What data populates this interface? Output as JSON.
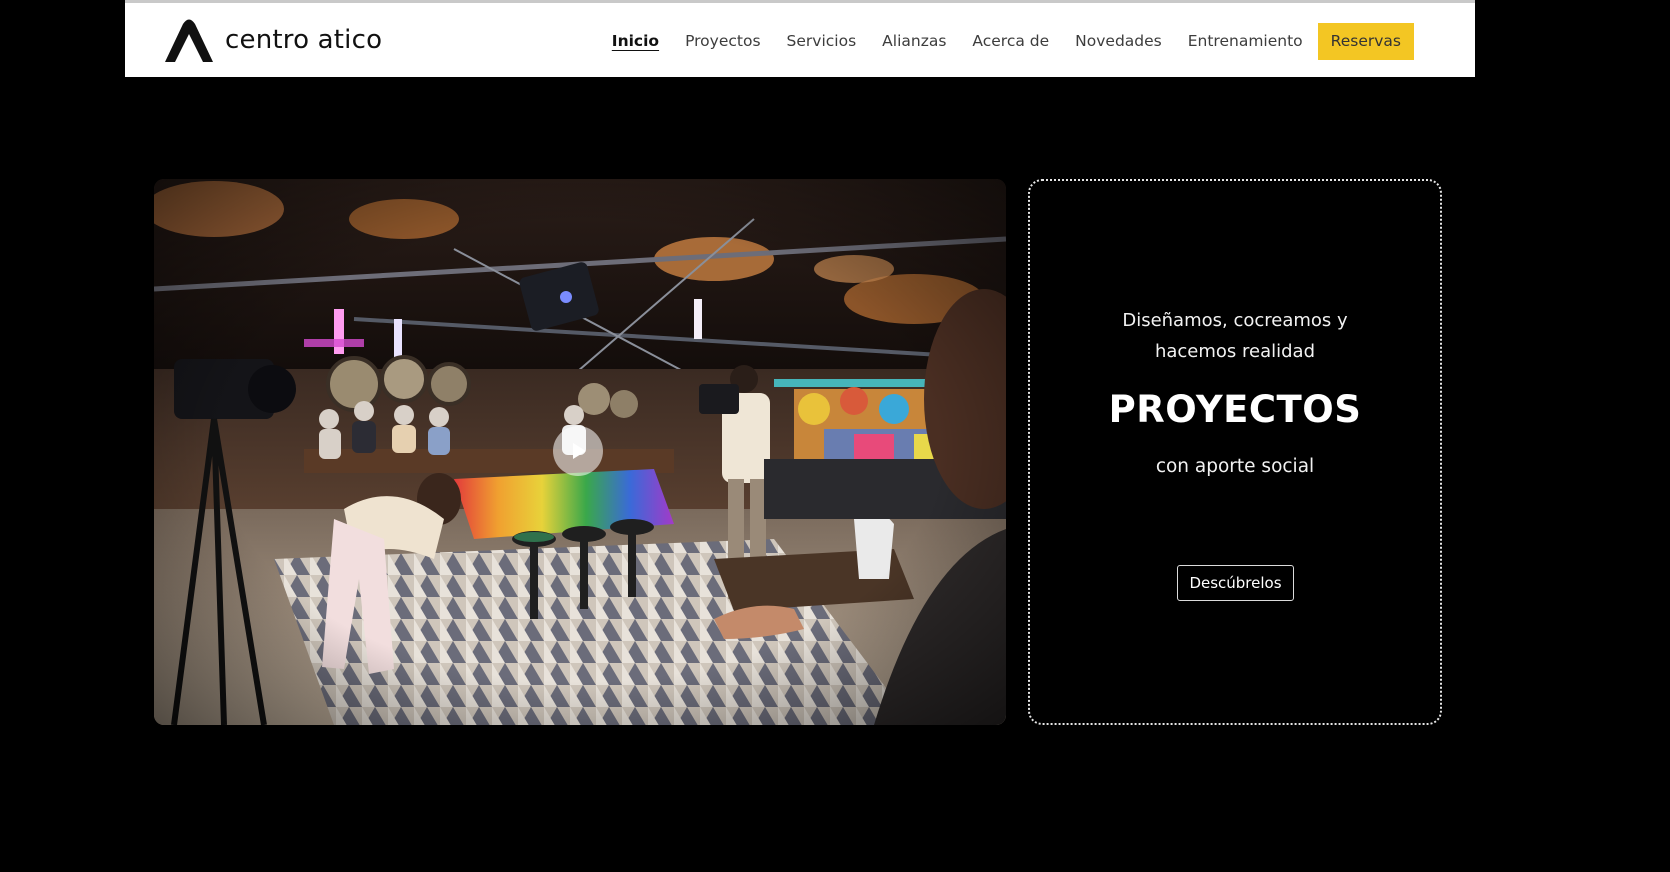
{
  "header": {
    "logo_text": "centro atico",
    "nav": [
      {
        "label": "Inicio",
        "active": true
      },
      {
        "label": "Proyectos"
      },
      {
        "label": "Servicios"
      },
      {
        "label": "Alianzas"
      },
      {
        "label": "Acerca de"
      },
      {
        "label": "Novedades"
      },
      {
        "label": "Entrenamiento"
      }
    ],
    "cta_label": "Reservas"
  },
  "hero": {
    "video_icon": "play-icon"
  },
  "card": {
    "lead": "Diseñamos, cocreamos y hacemos realidad",
    "title": "PROYECTOS",
    "subtitle": "con aporte social",
    "button_label": "Descúbrelos"
  },
  "colors": {
    "background": "#000000",
    "header_bg": "#ffffff",
    "cta_bg": "#f3c623",
    "card_border": "#e6e6e6"
  }
}
